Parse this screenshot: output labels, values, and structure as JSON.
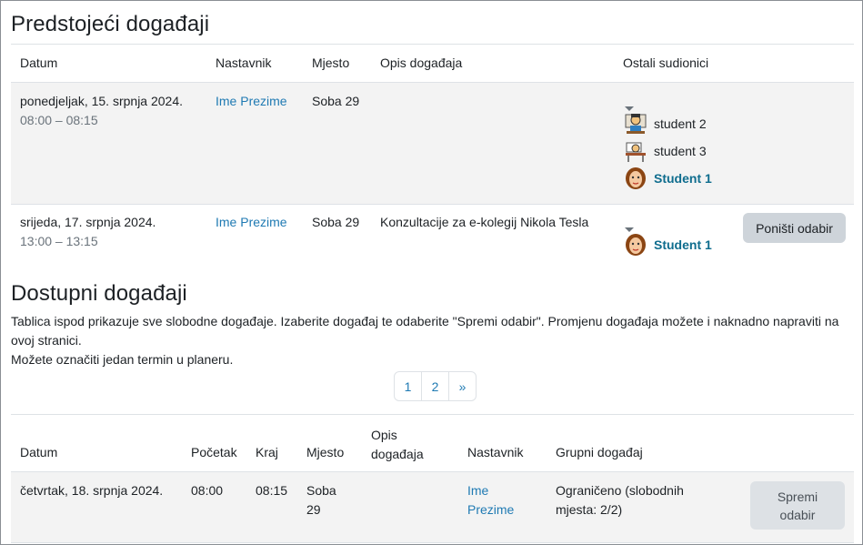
{
  "upcoming": {
    "title": "Predstojeći događaji",
    "headers": {
      "date": "Datum",
      "teacher": "Nastavnik",
      "location": "Mjesto",
      "description": "Opis događaja",
      "participants": "Ostali sudionici"
    },
    "rows": [
      {
        "date": "ponedjeljak, 15. srpnja 2024.",
        "time": "08:00 – 08:15",
        "teacher": "Ime Prezime",
        "location": "Soba 29",
        "description": "",
        "participants": [
          "student 2",
          "student 3",
          "Student 1"
        ]
      },
      {
        "date": "srijeda, 17. srpnja 2024.",
        "time": "13:00 – 13:15",
        "teacher": "Ime Prezime",
        "location": "Soba 29",
        "description": "Konzultacije za e-kolegij Nikola Tesla",
        "participants": [
          "Student 1"
        ],
        "button": "Poništi odabir"
      }
    ]
  },
  "available": {
    "title": "Dostupni događaji",
    "text1": "Tablica ispod prikazuje sve slobodne događaje. Izaberite događaj te odaberite \"Spremi odabir\". Promjenu događaja možete i naknadno napraviti na ovoj stranici.",
    "text2": "Možete označiti jedan termin u planeru.",
    "pager": [
      "1",
      "2",
      "»"
    ],
    "headers": {
      "date": "Datum",
      "start": "Početak",
      "end": "Kraj",
      "location": "Mjesto",
      "description": "Opis događaja",
      "teacher": "Nastavnik",
      "group": "Grupni događaj"
    },
    "rows": [
      {
        "date": "četvrtak, 18. srpnja 2024.",
        "start": "08:00",
        "end": "08:15",
        "location": "Soba 29",
        "description": "",
        "teacher": "Ime Prezime",
        "group": "Ograničeno (slobodnih mjesta: 2/2)",
        "button": "Spremi odabir"
      }
    ]
  }
}
